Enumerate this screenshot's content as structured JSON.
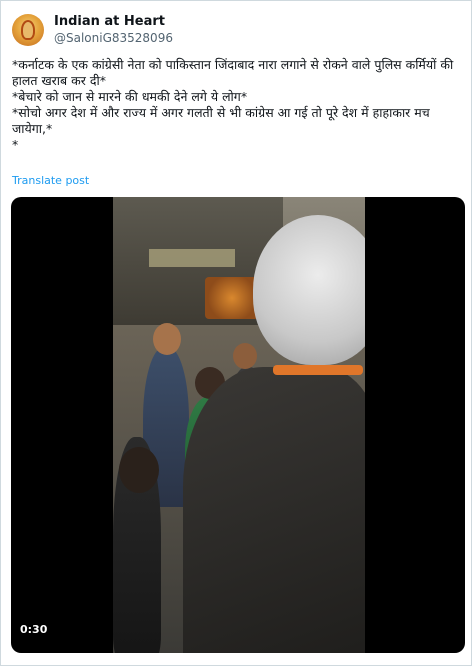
{
  "tweet": {
    "display_name": "Indian at Heart",
    "handle": "@SaloniG83528096",
    "text_lines": [
      "*कर्नाटक के एक कांग्रेसी नेता को पाकिस्तान जिंदाबाद नारा लगाने से रोकने वाले पुलिस कर्मियों की हालत खराब कर दी*",
      "*बेचारे को जान से मारने की धमकी देने लगे ये लोग*",
      "*सोचो अगर देश में और राज्य में अगर गलती से भी कांग्रेस आ गई तो पूरे देश में हाहाकार मच जायेगा,*",
      "*"
    ],
    "translate_label": "Translate post"
  },
  "media": {
    "duration": "0:30"
  },
  "colors": {
    "link": "#1d9bf0",
    "text": "#0f1419",
    "secondary": "#536471"
  }
}
